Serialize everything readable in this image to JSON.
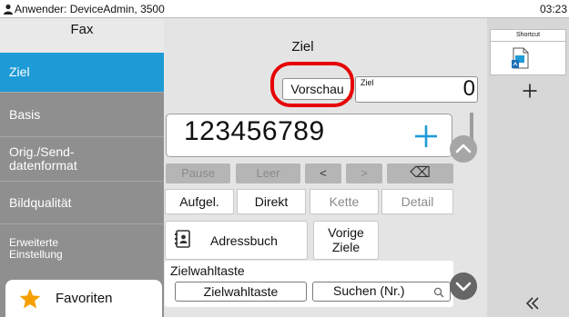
{
  "status": {
    "user": "Anwender: DeviceAdmin, 3500",
    "time": "03:23"
  },
  "sidebar": {
    "title": "Fax",
    "items": [
      {
        "label": "Ziel"
      },
      {
        "label": "Basis"
      },
      {
        "label": "Orig./Send-\ndatenformat"
      },
      {
        "label": "Bildqualität"
      },
      {
        "label": "Erweiterte\nEinstellung"
      }
    ],
    "favorites": "Favoriten"
  },
  "main": {
    "title": "Ziel",
    "preview_button": "Vorschau",
    "dest_label": "Ziel",
    "dest_count": "0",
    "number": "123456789",
    "keys": {
      "pause": "Pause",
      "space": "Leer",
      "left": "<",
      "right": ">",
      "backspace": "⌫"
    },
    "tabs": {
      "aufgel": "Aufgel.",
      "direkt": "Direkt",
      "kette": "Kette",
      "detail": "Detail"
    },
    "address_book": "Adressbuch",
    "previous_dest": "Vorige\nZiele",
    "speed_dial_title": "Zielwahltaste",
    "speed_dial_button": "Zielwahltaste",
    "search_button": "Suchen (Nr.)"
  },
  "shortcut": {
    "tab": "Shortcut"
  },
  "colors": {
    "accent": "#1e9bd7",
    "highlight": "#e60000",
    "sidebar_bg": "#8f8f8f",
    "panel_bg": "#e4e4e4"
  }
}
